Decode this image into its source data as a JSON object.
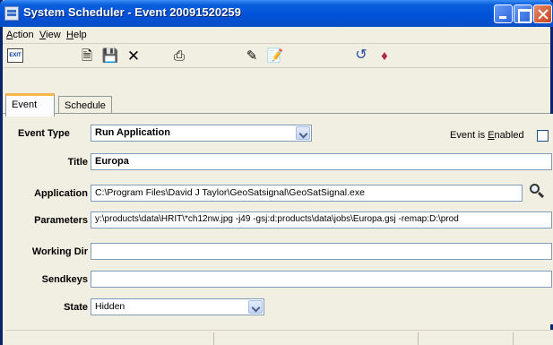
{
  "window": {
    "title": "System Scheduler - Event 20091520259"
  },
  "menu": [
    {
      "prefix": "",
      "underline": "A",
      "rest": "ction"
    },
    {
      "prefix": "",
      "underline": "V",
      "rest": "iew"
    },
    {
      "prefix": "",
      "underline": "H",
      "rest": "elp"
    }
  ],
  "toolbar": {
    "exit_label": "EXIT"
  },
  "tabs": [
    {
      "label": "Event",
      "active": true
    },
    {
      "label": "Schedule",
      "active": false
    }
  ],
  "form": {
    "event_type_label": "Event Type",
    "event_type_value": "Run Application",
    "enabled_label_prefix": "Event is ",
    "enabled_label_underline": "E",
    "enabled_label_rest": "nabled",
    "enabled_checked": false,
    "title_label": "Title",
    "title_value": "Europa",
    "application_label": "Application",
    "application_value": "C:\\Program Files\\David J Taylor\\GeoSatsignal\\GeoSatSignal.exe",
    "parameters_label": "Parameters",
    "parameters_value": "y:\\products\\data\\HRIT\\*ch12nw.jpg -j49 -gsj:d:products\\data\\jobs\\Europa.gsj -remap:D:\\prod",
    "working_dir_label": "Working Dir",
    "working_dir_value": "",
    "sendkeys_label": "Sendkeys",
    "sendkeys_value": "",
    "state_label": "State",
    "state_value": "Hidden"
  },
  "colors": {
    "title_bar": "#0050d8",
    "active_tab_accent": "#f7b64d",
    "field_border": "#7f9db9"
  },
  "icons": [
    "app-icon",
    "new-document-icon",
    "save-icon",
    "delete-icon",
    "print-icon",
    "properties-icon",
    "edit-icon",
    "refresh-icon",
    "tag-icon",
    "search-icon"
  ]
}
